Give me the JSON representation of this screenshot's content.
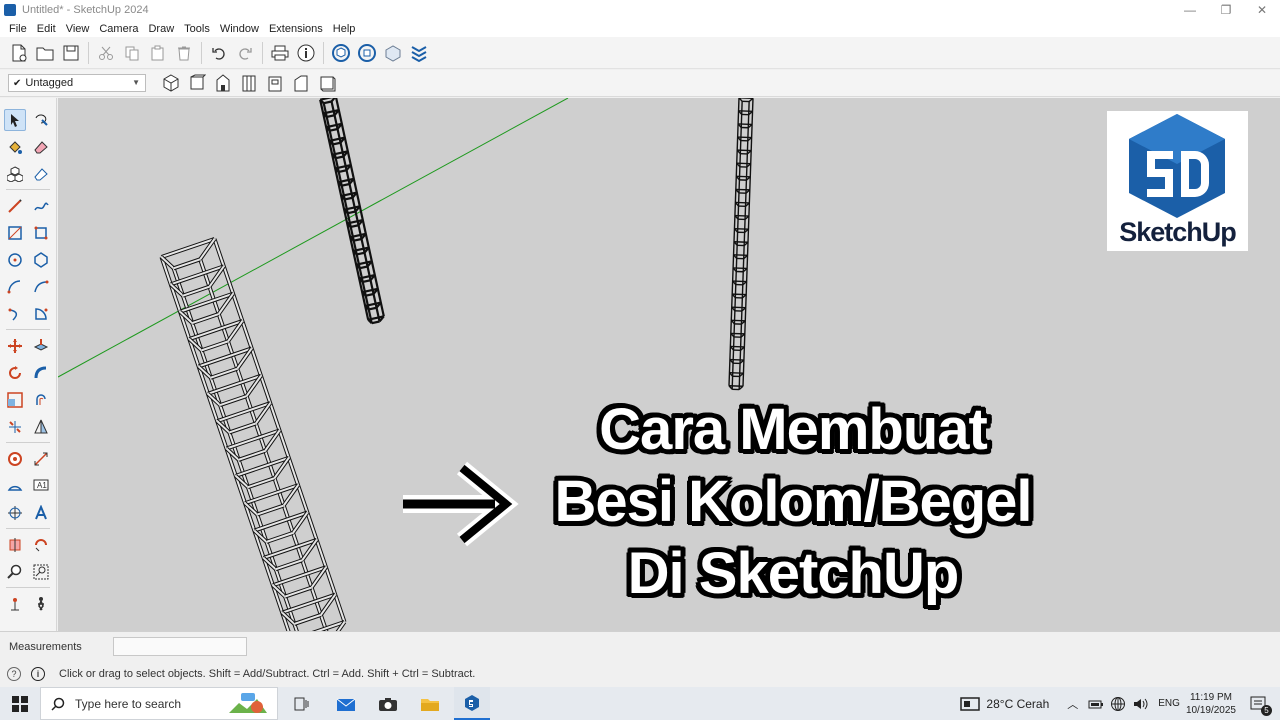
{
  "window": {
    "title": "Untitled* - SketchUp 2024",
    "controls": [
      "—",
      "❐",
      "✕"
    ]
  },
  "menu": [
    "File",
    "Edit",
    "View",
    "Camera",
    "Draw",
    "Tools",
    "Window",
    "Extensions",
    "Help"
  ],
  "tag_select": {
    "value": "Untagged"
  },
  "overlay": {
    "logo_text": "SketchUp",
    "headline": [
      "Cara Membuat",
      "Besi Kolom/Begel",
      "Di SketchUp"
    ]
  },
  "measurements": {
    "label": "Measurements",
    "value": ""
  },
  "status": {
    "text": "Click or drag to select objects. Shift = Add/Subtract. Ctrl = Add. Shift + Ctrl = Subtract."
  },
  "taskbar": {
    "search_placeholder": "Type here to search",
    "weather": "28°C  Cerah",
    "language": "ENG",
    "time": "11:19 PM",
    "date": "10/19/2025",
    "notifications": "5"
  },
  "colors": {
    "axis_green": "#1f9a1f",
    "logo_blue": "#1b5fa8",
    "logo_dark": "#14213d",
    "viewport_bg": "#cfcfcf"
  }
}
